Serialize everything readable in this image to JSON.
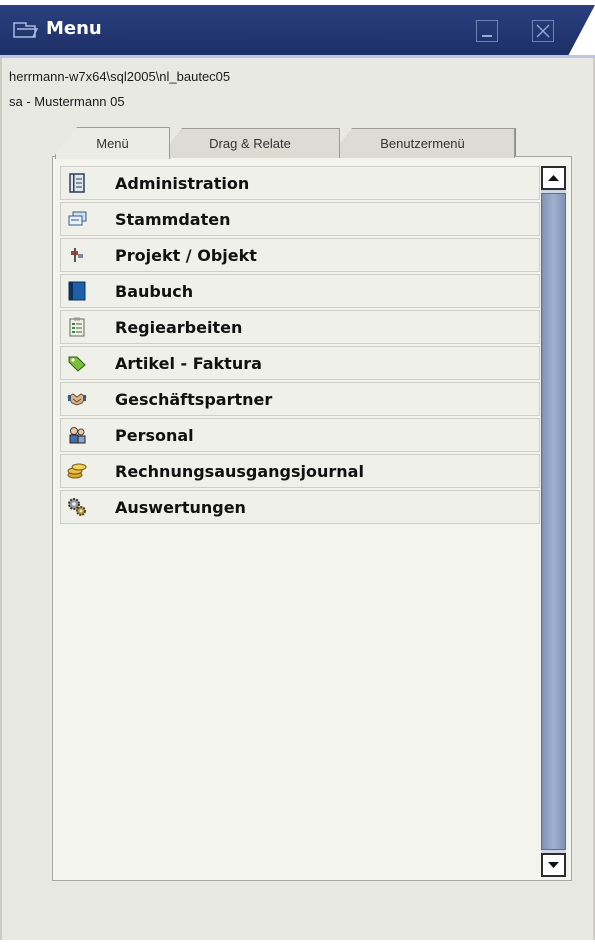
{
  "window": {
    "title": "Menu",
    "info_line1": "herrmann-w7x64\\sql2005\\nl_bautec05",
    "info_line2": "sa - Mustermann 05"
  },
  "tabs": [
    {
      "label": "Menü",
      "active": true
    },
    {
      "label": "Drag & Relate",
      "active": false
    },
    {
      "label": "Benutzermenü",
      "active": false
    }
  ],
  "menu": {
    "items": [
      {
        "label": "Administration",
        "icon": "administration-icon"
      },
      {
        "label": "Stammdaten",
        "icon": "stammdaten-icon"
      },
      {
        "label": "Projekt / Objekt",
        "icon": "projekt-icon"
      },
      {
        "label": "Baubuch",
        "icon": "baubuch-icon"
      },
      {
        "label": "Regiearbeiten",
        "icon": "regiearbeiten-icon"
      },
      {
        "label": "Artikel - Faktura",
        "icon": "artikel-icon"
      },
      {
        "label": "Geschäftspartner",
        "icon": "handshake-icon"
      },
      {
        "label": "Personal",
        "icon": "personal-icon"
      },
      {
        "label": "Rechnungsausgangsjournal",
        "icon": "coins-icon"
      },
      {
        "label": "Auswertungen",
        "icon": "gears-icon"
      }
    ]
  },
  "colors": {
    "titlebar": "#1d2f66",
    "panel": "#f4f4ef",
    "scroll_thumb": "#8fa2c4"
  }
}
